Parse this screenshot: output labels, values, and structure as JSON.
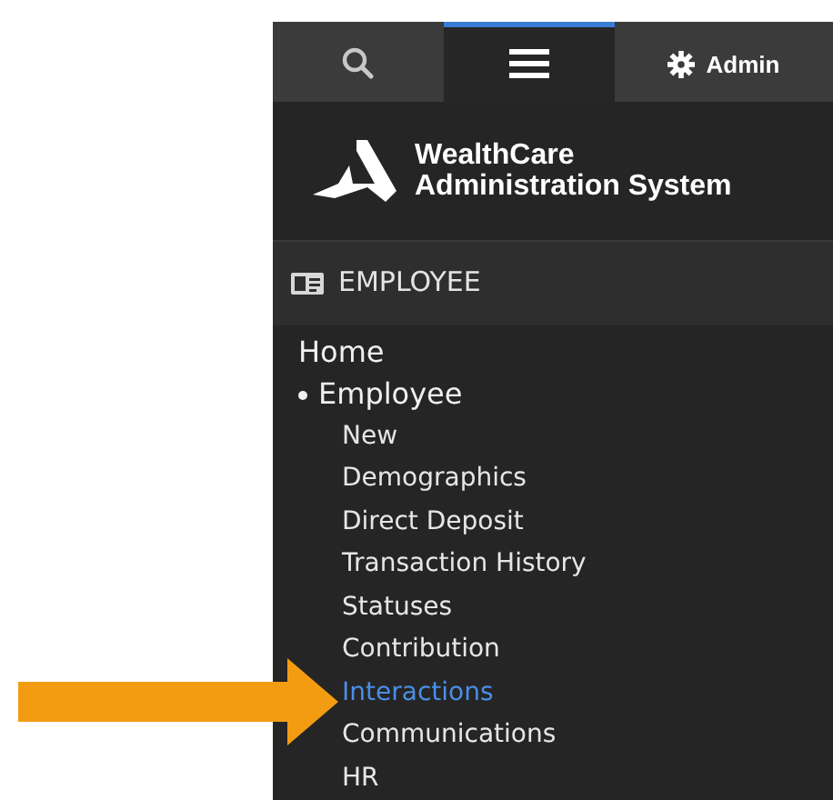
{
  "tabs": [
    {
      "kind": "search",
      "selected": false
    },
    {
      "kind": "menu",
      "selected": true
    },
    {
      "kind": "settings",
      "label": "Admin",
      "selected": false
    }
  ],
  "logo": {
    "line_1": "WealthCare",
    "line_2": "Administration System"
  },
  "section": {
    "title": "EMPLOYEE"
  },
  "nav": [
    {
      "label": "Home",
      "bullet": false
    },
    {
      "label": "Employee",
      "bullet": true,
      "children": [
        {
          "label": "New",
          "selected": false
        },
        {
          "label": "Demographics",
          "selected": false
        },
        {
          "label": "Direct Deposit",
          "selected": false
        },
        {
          "label": "Transaction History",
          "selected": false
        },
        {
          "label": "Statuses",
          "selected": false
        },
        {
          "label": "Contribution",
          "selected": false
        },
        {
          "label": "Interactions",
          "selected": true
        },
        {
          "label": "Communications",
          "selected": false
        },
        {
          "label": "HR",
          "selected": false
        }
      ]
    }
  ]
}
